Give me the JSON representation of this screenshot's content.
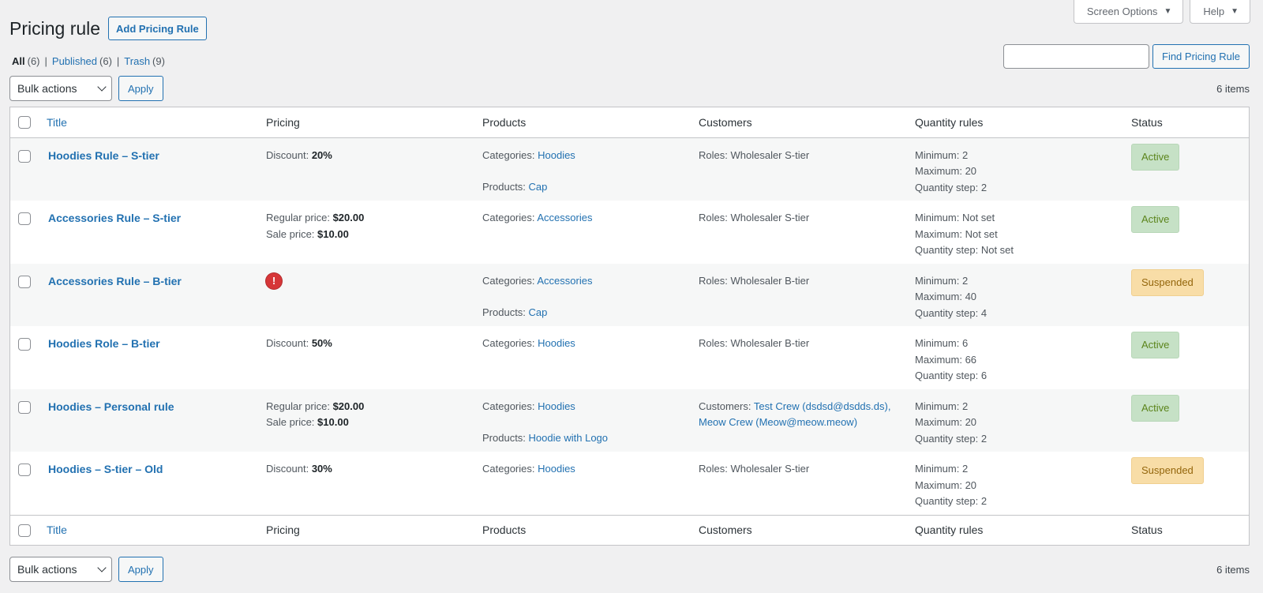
{
  "screen_meta": {
    "screen_options": "Screen Options",
    "help": "Help"
  },
  "page_title": "Pricing rule",
  "add_new": "Add Pricing Rule",
  "views": [
    {
      "label": "All",
      "count": "(6)"
    },
    {
      "label": "Published",
      "count": "(6)"
    },
    {
      "label": "Trash",
      "count": "(9)"
    }
  ],
  "search": {
    "button": "Find Pricing Rule",
    "placeholder": ""
  },
  "tablenav": {
    "bulk_actions": "Bulk actions",
    "apply": "Apply",
    "items": "6 items"
  },
  "columns": {
    "title": "Title",
    "pricing": "Pricing",
    "products": "Products",
    "customers": "Customers",
    "quantity": "Quantity rules",
    "status": "Status"
  },
  "icons": {
    "warning": "exclamation-icon",
    "dropdown": "chevron-down-icon",
    "caret": "caret-down-icon"
  },
  "colors": {
    "link": "#2271b1",
    "active_bg": "#c6e1c6",
    "active_text": "#5b841b",
    "suspended_bg": "#f8dda7",
    "suspended_text": "#94660c",
    "error": "#d63638"
  },
  "rows": [
    {
      "title": "Hoodies Rule – S-tier",
      "pricing": {
        "discount_label": "Discount:",
        "discount": "20%"
      },
      "products": {
        "categories_label": "Categories:",
        "categories": "Hoodies",
        "products_label": "Products:",
        "products": "Cap"
      },
      "customers": {
        "roles_label": "Roles:",
        "roles": "Wholesaler S-tier"
      },
      "qty": {
        "min_label": "Minimum:",
        "min": "2",
        "max_label": "Maximum:",
        "max": "20",
        "step_label": "Quantity step:",
        "step": "2"
      },
      "status": "Active"
    },
    {
      "title": "Accessories Rule – S-tier",
      "pricing": {
        "regular_label": "Regular price:",
        "regular": "$20.00",
        "sale_label": "Sale price:",
        "sale": "$10.00"
      },
      "products": {
        "categories_label": "Categories:",
        "categories": "Accessories"
      },
      "customers": {
        "roles_label": "Roles:",
        "roles": "Wholesaler S-tier"
      },
      "qty": {
        "min_label": "Minimum:",
        "min": "Not set",
        "max_label": "Maximum:",
        "max": "Not set",
        "step_label": "Quantity step:",
        "step": "Not set"
      },
      "status": "Active"
    },
    {
      "title": "Accessories Rule – B-tier",
      "pricing": {
        "warning": "!"
      },
      "products": {
        "categories_label": "Categories:",
        "categories": "Accessories",
        "products_label": "Products:",
        "products": "Cap"
      },
      "customers": {
        "roles_label": "Roles:",
        "roles": "Wholesaler B-tier"
      },
      "qty": {
        "min_label": "Minimum:",
        "min": "2",
        "max_label": "Maximum:",
        "max": "40",
        "step_label": "Quantity step:",
        "step": "4"
      },
      "status": "Suspended"
    },
    {
      "title": "Hoodies Role – B-tier",
      "pricing": {
        "discount_label": "Discount:",
        "discount": "50%"
      },
      "products": {
        "categories_label": "Categories:",
        "categories": "Hoodies"
      },
      "customers": {
        "roles_label": "Roles:",
        "roles": "Wholesaler B-tier"
      },
      "qty": {
        "min_label": "Minimum:",
        "min": "6",
        "max_label": "Maximum:",
        "max": "66",
        "step_label": "Quantity step:",
        "step": "6"
      },
      "status": "Active"
    },
    {
      "title": "Hoodies – Personal rule",
      "pricing": {
        "regular_label": "Regular price:",
        "regular": "$20.00",
        "sale_label": "Sale price:",
        "sale": "$10.00"
      },
      "products": {
        "categories_label": "Categories:",
        "categories": "Hoodies",
        "products_label": "Products:",
        "products": "Hoodie with Logo"
      },
      "customers": {
        "customers_label": "Customers:",
        "customer1": "Test Crew (dsdsd@dsdds.ds),",
        "customer2": "Meow Crew (Meow@meow.meow)"
      },
      "qty": {
        "min_label": "Minimum:",
        "min": "2",
        "max_label": "Maximum:",
        "max": "20",
        "step_label": "Quantity step:",
        "step": "2"
      },
      "status": "Active"
    },
    {
      "title": "Hoodies – S-tier – Old",
      "pricing": {
        "discount_label": "Discount:",
        "discount": "30%"
      },
      "products": {
        "categories_label": "Categories:",
        "categories": "Hoodies"
      },
      "customers": {
        "roles_label": "Roles:",
        "roles": "Wholesaler S-tier"
      },
      "qty": {
        "min_label": "Minimum:",
        "min": "2",
        "max_label": "Maximum:",
        "max": "20",
        "step_label": "Quantity step:",
        "step": "2"
      },
      "status": "Suspended"
    }
  ]
}
